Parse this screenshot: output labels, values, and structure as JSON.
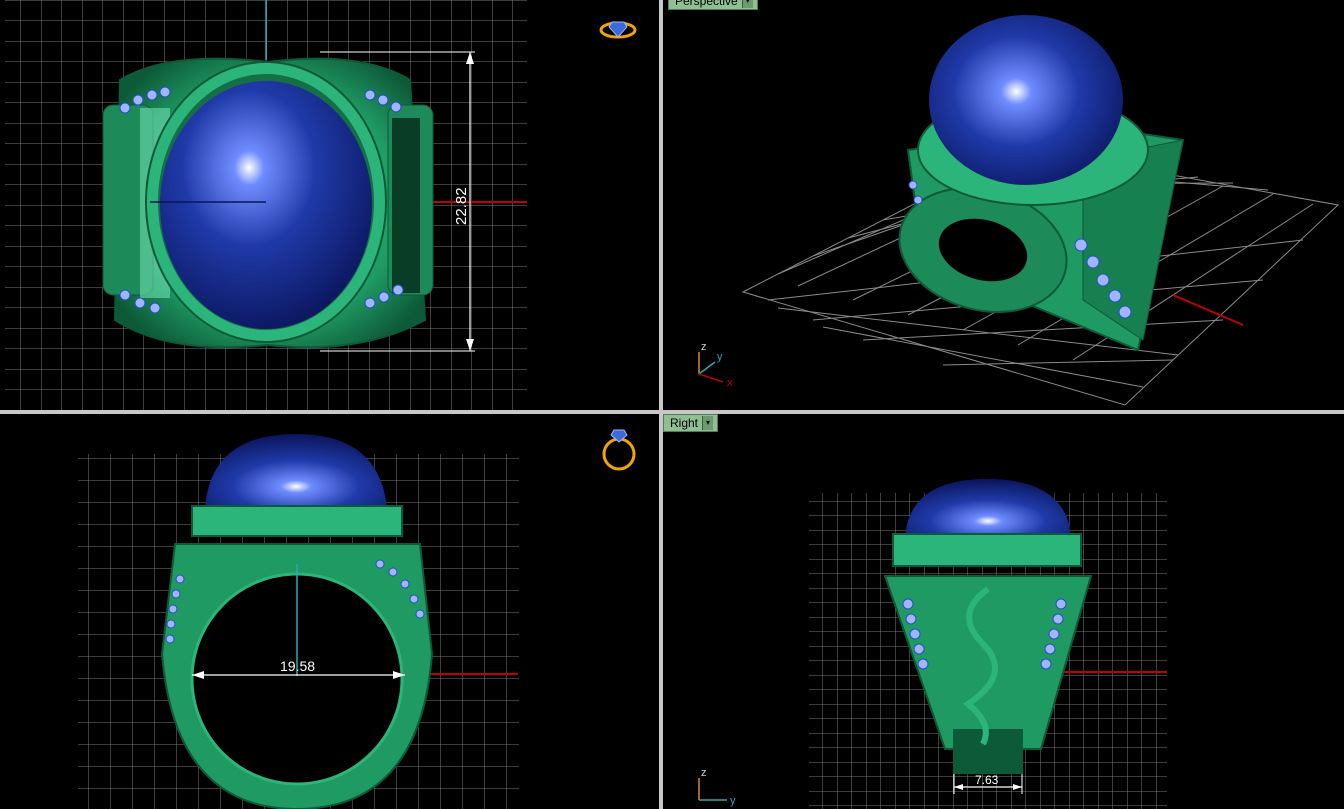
{
  "viewports": {
    "top": {
      "dimension": "22.82"
    },
    "perspective": {
      "label": "Perspective",
      "axis_z": "z",
      "axis_y": "y",
      "axis_x": "x"
    },
    "front": {
      "dimension": "19.58"
    },
    "right": {
      "label": "Right",
      "dimension": "7.63",
      "axis_z": "z",
      "axis_y": "y"
    }
  },
  "colors": {
    "background": "#000000",
    "grid": "#8a8a8a",
    "ring_metal": "#1f9a63",
    "gemstone": "#1f3aa8",
    "accent_stones": "#9fb6ff",
    "x_axis": "#c00000",
    "y_axis": "#2aa9b3",
    "tab_bg": "#8fbf92"
  },
  "icons": [
    "ring-gizmo-top-icon",
    "ring-gizmo-front-icon",
    "dropdown-arrow-icon"
  ]
}
